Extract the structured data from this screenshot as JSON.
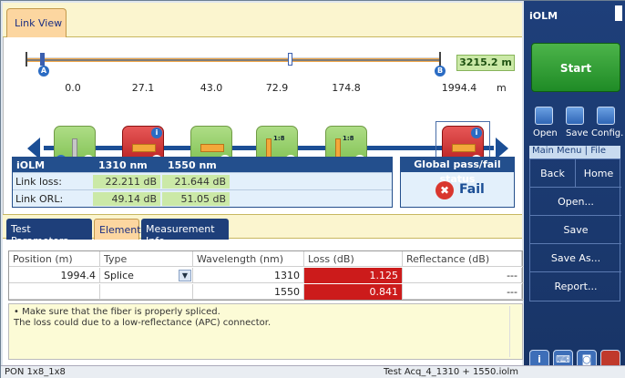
{
  "tabs": {
    "link_view": "Link View"
  },
  "overview": {
    "span_length": "3215.2 m",
    "marker_a": "A",
    "marker_b": "B"
  },
  "distances": [
    "0.0",
    "27.1",
    "43.0",
    "72.9",
    "174.8",
    "1994.4"
  ],
  "distance_unit": "m",
  "elements": [
    {
      "kind": "launch",
      "status": "pass",
      "label": ""
    },
    {
      "kind": "splice",
      "status": "fail",
      "label": ""
    },
    {
      "kind": "splice",
      "status": "pass",
      "label": ""
    },
    {
      "kind": "splitter",
      "status": "pass",
      "label": "1:8"
    },
    {
      "kind": "splitter",
      "status": "pass",
      "label": "1:8"
    },
    {
      "kind": "splice",
      "status": "fail",
      "label": ""
    }
  ],
  "summary": {
    "title": "iOLM",
    "col1": "1310 nm",
    "col2": "1550 nm",
    "link_loss_label": "Link loss:",
    "link_loss_1310": "22.211 dB",
    "link_loss_1550": "21.644 dB",
    "link_orl_label": "Link ORL:",
    "link_orl_1310": "49.14 dB",
    "link_orl_1550": "51.05 dB"
  },
  "global_status": {
    "title": "Global pass/fail status",
    "value": "Fail"
  },
  "lower_tabs": [
    "Test Parameters",
    "Element",
    "Measurement Info"
  ],
  "grid": {
    "headers": [
      "Position (m)",
      "Type",
      "Wavelength (nm)",
      "Loss (dB)",
      "Reflectance (dB)"
    ],
    "rows": [
      {
        "position": "1994.4",
        "type": "Splice",
        "wavelength": "1310",
        "loss": "1.125",
        "reflectance": "---"
      },
      {
        "position": "",
        "type": "",
        "wavelength": "1550",
        "loss": "0.841",
        "reflectance": "---"
      }
    ]
  },
  "message": {
    "line1": "• Make sure that the fiber is properly spliced.",
    "line2": "The loss could due to a low-reflectance (APC) connector."
  },
  "status_bar": {
    "left": "PON 1x8_1x8",
    "right": "Test Acq_4_1310 + 1550.iolm"
  },
  "right_panel": {
    "title": "iOLM",
    "start": "Start",
    "toolbar": [
      "Open",
      "Save",
      "Config."
    ],
    "menu_header": "Main Menu | File",
    "back": "Back",
    "home": "Home",
    "items": [
      "Open...",
      "Save",
      "Save As...",
      "Report..."
    ]
  },
  "colors": {
    "pass_green": "#7dbf4f",
    "fail_red": "#cc1b1b",
    "accent_blue": "#234f8d",
    "panel_blue": "#1e3f7a"
  }
}
